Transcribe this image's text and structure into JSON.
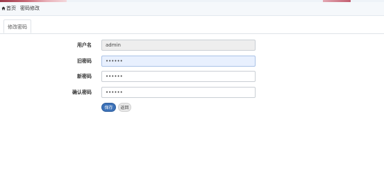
{
  "breadcrumb": {
    "home_label": "首页",
    "separator": "/",
    "current": "密码修改"
  },
  "tabs": [
    {
      "label": "修改密码",
      "active": true
    }
  ],
  "form": {
    "username": {
      "label": "用户名",
      "value": "admin"
    },
    "old_password": {
      "label": "旧密码",
      "value": "••••••"
    },
    "new_password": {
      "label": "新密码",
      "value": "••••••"
    },
    "confirm_password": {
      "label": "确认密码",
      "value": "••••••"
    }
  },
  "buttons": {
    "save_label": "保存",
    "back_label": "返回"
  },
  "colors": {
    "primary": "#3d72b8",
    "autofill": "#e8f0fe",
    "readonly": "#eeeeee"
  },
  "icons": {
    "home": "home-icon"
  }
}
